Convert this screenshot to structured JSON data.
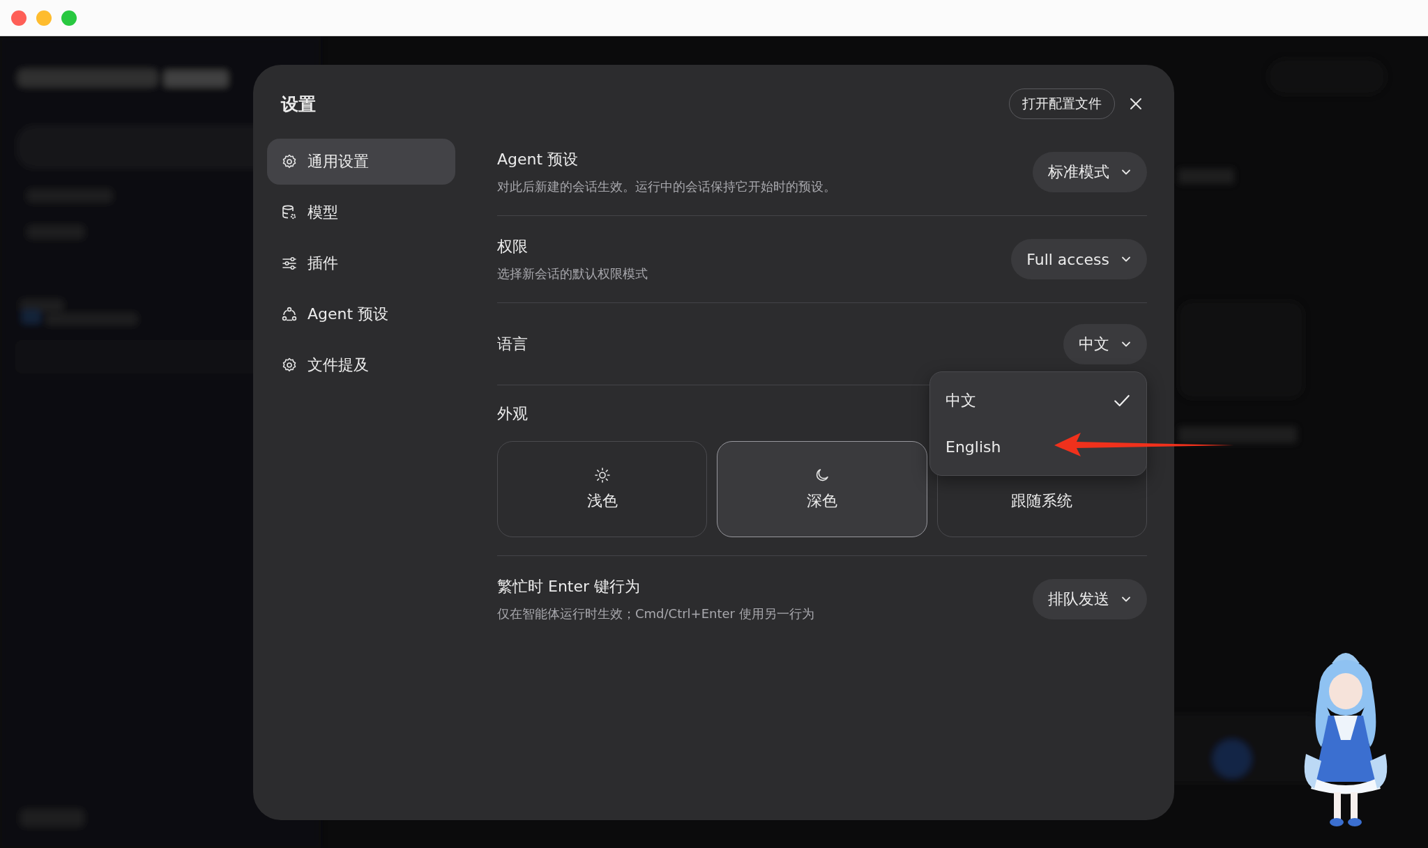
{
  "dialog": {
    "title": "设置",
    "header_button": "打开配置文件",
    "nav": [
      {
        "label": "通用设置",
        "selected": true
      },
      {
        "label": "模型",
        "selected": false
      },
      {
        "label": "插件",
        "selected": false
      },
      {
        "label": "Agent 预设",
        "selected": false
      },
      {
        "label": "文件提及",
        "selected": false
      }
    ],
    "rows": [
      {
        "kind": "select",
        "title": "Agent 预设",
        "description": "对此后新建的会话生效。运行中的会话保持它开始时的预设。",
        "value": "标准模式"
      },
      {
        "kind": "select",
        "title": "权限",
        "description": "选择新会话的默认权限模式",
        "value": "Full access"
      },
      {
        "kind": "select",
        "title": "语言",
        "value": "中文",
        "menu": [
          {
            "label": "中文",
            "selected": true
          },
          {
            "label": "English",
            "selected": false
          }
        ]
      },
      {
        "kind": "appearance",
        "title": "外观",
        "options": [
          {
            "label": "浅色",
            "selected": false
          },
          {
            "label": "深色",
            "selected": true
          },
          {
            "label": "跟随系统",
            "selected": false
          }
        ]
      },
      {
        "kind": "select",
        "title": "繁忙时 Enter 键行为",
        "description": "仅在智能体运行时生效；Cmd/Ctrl+Enter 使用另一行为",
        "value": "排队发送"
      }
    ]
  }
}
